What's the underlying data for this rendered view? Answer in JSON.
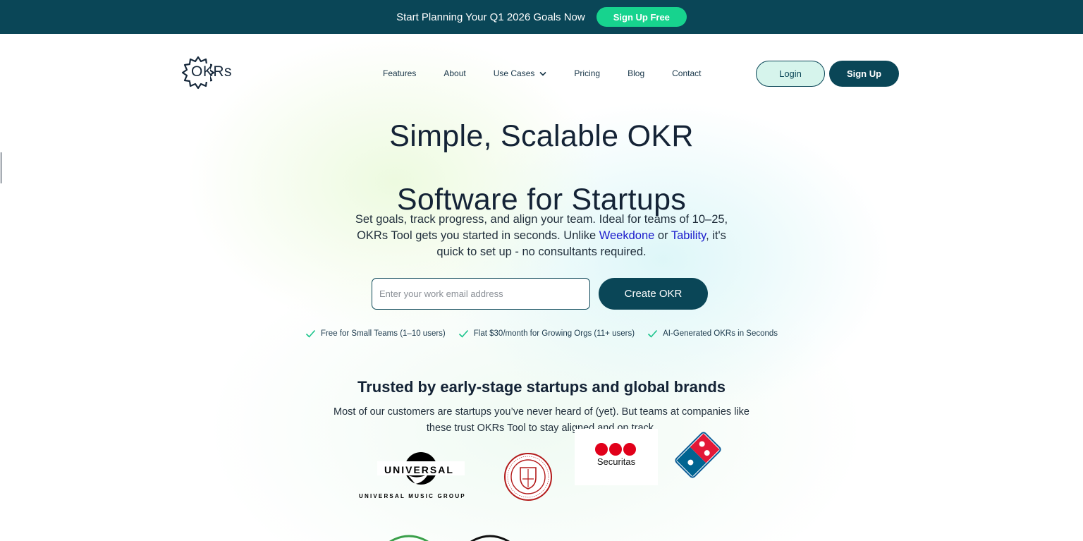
{
  "announcement": {
    "text": "Start Planning Your Q1 2026 Goals Now",
    "button_label": "Sign Up Free",
    "bg_color": "#0a4657",
    "button_color": "#17d38e"
  },
  "header": {
    "logo_text": "OKRs",
    "nav": [
      {
        "label": "Features"
      },
      {
        "label": "About"
      },
      {
        "label": "Use Cases",
        "has_dropdown": true
      },
      {
        "label": "Pricing"
      },
      {
        "label": "Blog"
      },
      {
        "label": "Contact"
      }
    ],
    "login_label": "Login",
    "signup_label": "Sign Up"
  },
  "hero": {
    "title_line1": "Simple, Scalable OKR",
    "title_line2": "Software for Startups",
    "subtitle_part1": "Set goals, track progress, and align your team. Ideal for teams of 10–25, OKRs Tool gets you started in seconds. Unlike ",
    "link_weekdone": "Weekdone",
    "subtitle_part2": " or ",
    "link_tability": "Tability",
    "subtitle_part3": ", it's quick to set up - no consultants required.",
    "email_placeholder": "Enter your work email address",
    "email_value": "",
    "cta_label": "Create OKR",
    "perks": [
      "Free for Small Teams (1–10 users)",
      "Flat $30/month for Growing Orgs (11+ users)",
      "AI-Generated OKRs in Seconds"
    ]
  },
  "trust": {
    "title": "Trusted by early-stage startups and global brands",
    "subtitle": "Most of our customers are startups you’ve never heard of (yet). But teams at companies like these trust OKRs Tool to stay aligned and on track.",
    "logos": {
      "universal_word": "UNIVERSAL",
      "universal_group": "UNIVERSAL MUSIC GROUP",
      "securitas": "Securitas"
    }
  },
  "colors": {
    "primary": "#0a4657",
    "accent": "#17d38e",
    "link": "#1a1acc",
    "check": "#17c38a"
  }
}
